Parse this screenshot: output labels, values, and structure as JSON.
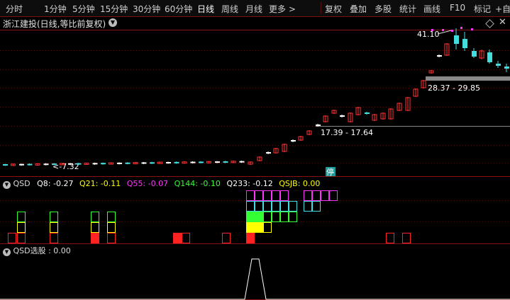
{
  "toolbar": {
    "period_tabs": [
      "分时",
      "1分钟",
      "5分钟",
      "15分钟",
      "30分钟",
      "60分钟",
      "日线",
      "周线",
      "月线",
      "更多 >"
    ],
    "active_tab": "日线",
    "actions": [
      "复权",
      "叠加",
      "多股",
      "统计",
      "画线",
      "F10",
      "标记",
      "+自"
    ]
  },
  "title": {
    "stock_name": "浙江建投(日线,等比前复权)"
  },
  "price_chart": {
    "high_label": "41.10",
    "low_label": "7.32",
    "range_upper": "28.37 - 29.85",
    "range_lower": "17.39 - 17.64",
    "limit_badge": "停",
    "colors": {
      "up": "#ff3333",
      "down": "#44dddd",
      "flat": "#ffffff",
      "marker": "#ff33ff"
    }
  },
  "indicator_qsd": {
    "name": "QSD",
    "items": [
      {
        "label": "Q8: -0.27",
        "color": "#ffffff"
      },
      {
        "label": "Q21: -0.11",
        "color": "#ffff00"
      },
      {
        "label": "Q55: -0.07",
        "color": "#ff33ff"
      },
      {
        "label": "Q144: -0.10",
        "color": "#33ff33"
      },
      {
        "label": "Q233: -0.12",
        "color": "#ffffff"
      },
      {
        "label": "QSJB: 0.00",
        "color": "#ffff00"
      }
    ]
  },
  "indicator_select": {
    "label": "QSD选股 : 0.00"
  }
}
